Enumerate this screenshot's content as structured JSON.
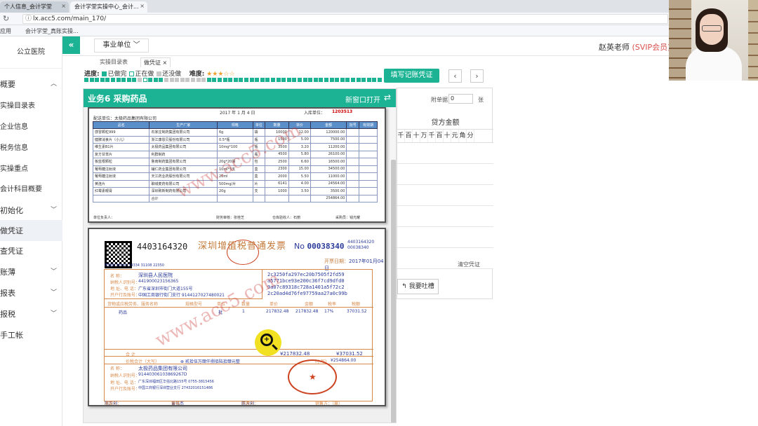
{
  "browser": {
    "tabs": [
      {
        "label": "个人信息_会计学堂"
      },
      {
        "label": "会计学堂实操中心_会计..."
      }
    ],
    "url": "lx.acc5.com/main_170/",
    "bookmarks": [
      "应用",
      "会计学堂_真账实操..."
    ]
  },
  "sidebar": {
    "title": "公立医院",
    "items": [
      {
        "label": "概要",
        "main": true,
        "chevron": "up"
      },
      {
        "label": "实操目录表"
      },
      {
        "label": "企业信息"
      },
      {
        "label": "税务信息"
      },
      {
        "label": "实操重点"
      },
      {
        "label": "会计科目概要"
      },
      {
        "label": "初始化",
        "main": true,
        "chevron": "down"
      },
      {
        "label": "做凭证",
        "main": true,
        "active": true
      },
      {
        "label": "查凭证",
        "main": true
      },
      {
        "label": "账薄",
        "main": true,
        "chevron": "down"
      },
      {
        "label": "报表",
        "main": true,
        "chevron": "down"
      },
      {
        "label": "报税",
        "main": true,
        "chevron": "down"
      },
      {
        "label": "手工帐",
        "main": true
      }
    ]
  },
  "topbar": {
    "collapse": "«",
    "unit_select": "事业单位 ﹀",
    "teacher": "赵英老师",
    "vip": "(SVIP会员)"
  },
  "tabs": [
    {
      "label": "实操目录表"
    },
    {
      "label": "做凭证",
      "active": true
    }
  ],
  "progress": {
    "label": "进度:",
    "done": "已做完",
    "doing": "正在做",
    "todo": "还没做",
    "difficulty": "难度:",
    "stars": "★★★☆☆",
    "done_color": "#1bb394",
    "doing_color": "#ffffff",
    "todo_color": "#c8c8c8"
  },
  "actions": {
    "fill_voucher": "填写记账凭证",
    "prev": "‹",
    "next": "›",
    "complain": "我要吐槽"
  },
  "voucher": {
    "attach_label": "附单据",
    "attach_value": "0",
    "zhang": "张",
    "credit_title": "贷方金额",
    "units": [
      "千",
      "百",
      "十",
      "万",
      "千",
      "百",
      "十",
      "元",
      "角",
      "分"
    ],
    "clear": "清空凭证"
  },
  "panel": {
    "title": "业务6 采购药品",
    "open_new": "新窗口打开",
    "swap_icon": "⇄"
  },
  "receipt": {
    "date": "2017 年 1 月 4 日",
    "number_label": "入库单位：",
    "number": "1203513",
    "vendor": "配送单位：太极药品集团有限公司",
    "headers": [
      "品名",
      "生产厂家",
      "规格",
      "单位",
      "数量",
      "单价",
      "金额",
      "批号",
      "有效期"
    ],
    "rows": [
      [
        "感冒颗粒999",
        "石家庄制药集团有限公司",
        "6g",
        "袋",
        "10000",
        "12.00",
        "120000.00",
        "",
        ""
      ],
      [
        "健脾消食片（小儿）",
        "浙江康恩贝股份有限公司",
        "0.5*瓶",
        "瓶",
        "1500",
        "5.00",
        "7500.00",
        "",
        ""
      ],
      [
        "维生素B1片",
        "太极药品集团有限公司",
        "10mg*100",
        "瓶",
        "3500",
        "3.20",
        "11200.00",
        "",
        ""
      ],
      [
        "复方甘草片",
        "利群制药",
        "",
        "瓶",
        "4500",
        "5.80",
        "26100.00",
        "",
        ""
      ],
      [
        "板蓝根颗粒",
        "鲁南制药集团有限公司",
        "20g*20袋",
        "包",
        "2500",
        "6.60",
        "16500.00",
        "",
        ""
      ],
      [
        "葡萄糖注射液",
        "辅仁药业集团有限公司",
        "10ml*5支",
        "盒",
        "2300",
        "15.00",
        "34500.00",
        "",
        ""
      ],
      [
        "葡萄糖注射液",
        "天江药业药股份有限公司",
        "20ml",
        "盒",
        "2000",
        "5.50",
        "11000.00",
        "",
        ""
      ],
      [
        "黄连片",
        "聊城麦药有限公司",
        "500mg/片",
        "片",
        "6141",
        "4.00",
        "24564.00",
        "",
        ""
      ],
      [
        "红霉素眼膏",
        "深圳致新制药有限公司",
        "20g",
        "支",
        "1000",
        "3.50",
        "3500.00",
        "",
        ""
      ]
    ],
    "total_label": "合计",
    "total": "254864.00",
    "foot": [
      "单位负责人：",
      "财务审核：张桂芝",
      "仓库验收人：石丽",
      "采购员：钱光耀"
    ]
  },
  "invoice": {
    "code": "4403164320",
    "title": "深圳增值税普通发票",
    "no_label": "No",
    "no": "00038340",
    "codes_right": [
      "4403164320",
      "00038340"
    ],
    "date_label": "开票日期：",
    "date": "2017年01月04日",
    "verify": "校验码 68564 54334 31108 22350",
    "buyer_labels": [
      "名      称：",
      "纳税人识别号：",
      "地 址、电 话：",
      "开户行及账号："
    ],
    "buyer_values": [
      "深圳县人民医院",
      "441900023156365",
      "广东省深圳市街门大道155号",
      "中国工商银行街门支行 9144127027480021"
    ],
    "pw_lines": [
      "2c3250fa297ec20b7505f2fd59",
      "a5771bce93e200c36f7cd9dfd0",
      "9a07c89318c728a1401a5f72c2",
      "2c20ad4d76fe97759aa27a0c99b"
    ],
    "item_headers": [
      "货物或应税劳务、服务名称",
      "规格型号",
      "单位",
      "数量",
      "单价",
      "金额",
      "税率",
      "税额"
    ],
    "item": [
      "药品",
      "批",
      "1",
      "217832.48",
      "217832.48",
      "17%",
      "37031.52"
    ],
    "total_label": "合      计",
    "amount_total": "¥217832.48",
    "tax_total": "¥37031.52",
    "sum_label": "价税合计（大写）",
    "sum_words": "⊗ 贰拾伍万肆仟捌佰陆拾肆元整",
    "sum_small_label": "（小写）",
    "sum_small": "¥254864.00",
    "seller_labels": [
      "名      称：",
      "纳税人识别号：",
      "地 址、电 话：",
      "开户行及账号："
    ],
    "seller_values": [
      "太极药品集团有限公司",
      "91440306103869267D",
      "广东深圳福田区华强北路155号 0755-3815456",
      "中国工商银行深圳营业支行 27432016151486"
    ],
    "foot": [
      "收款人：",
      "陈方创",
      "复核：",
      "黄伟杰",
      "开票人：",
      "陈方创",
      "销售方：（章）"
    ],
    "watermark": "www.acc5.com"
  }
}
